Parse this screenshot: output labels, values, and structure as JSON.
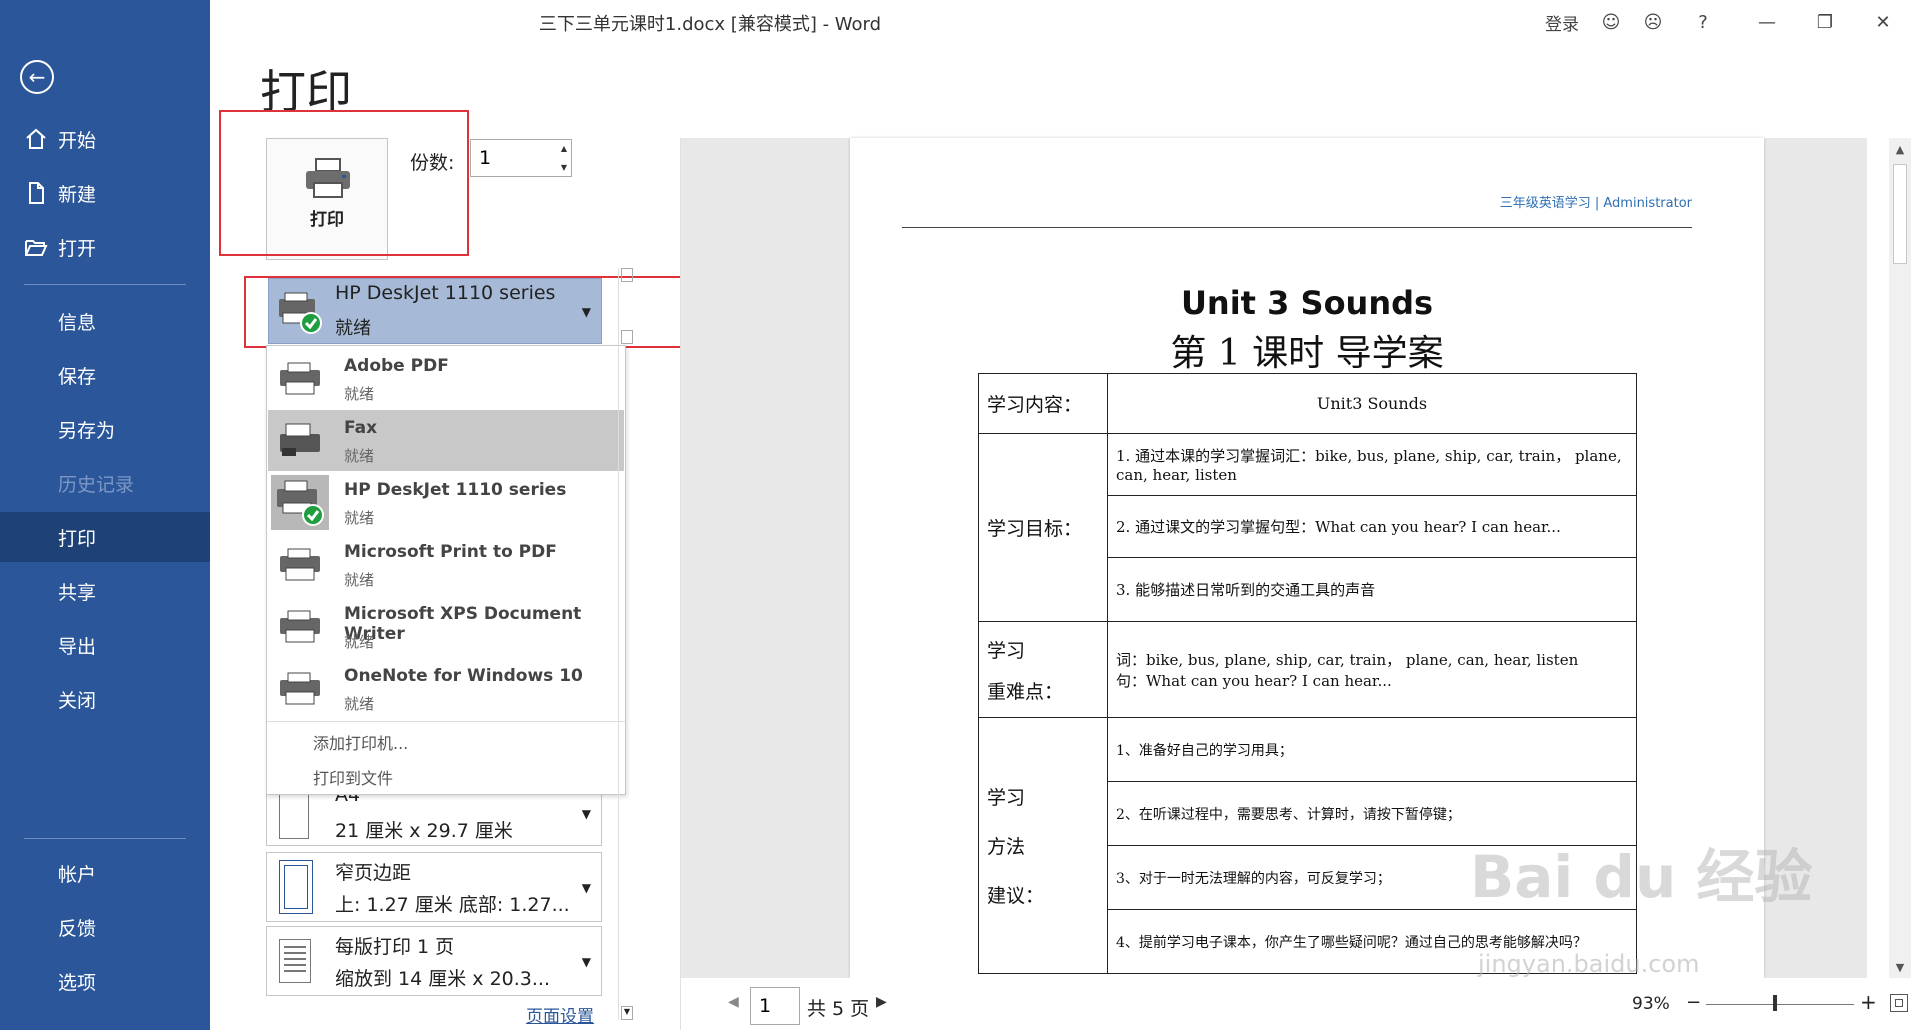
{
  "window": {
    "title": "三下三单元课时1.docx [兼容模式]  -  Word",
    "sign_in": "登录",
    "help": "?"
  },
  "sidebar": {
    "items": [
      {
        "label": "开始",
        "icon": "home-icon"
      },
      {
        "label": "新建",
        "icon": "new-document-icon"
      },
      {
        "label": "打开",
        "icon": "open-folder-icon"
      },
      {
        "label": "信息"
      },
      {
        "label": "保存"
      },
      {
        "label": "另存为"
      },
      {
        "label": "历史记录"
      },
      {
        "label": "打印"
      },
      {
        "label": "共享"
      },
      {
        "label": "导出"
      },
      {
        "label": "关闭"
      },
      {
        "label": "帐户"
      },
      {
        "label": "反馈"
      },
      {
        "label": "选项"
      }
    ]
  },
  "print": {
    "title": "打印",
    "button_label": "打印",
    "copies_label": "份数:",
    "copies_value": "1",
    "selected_printer": {
      "name": "HP DeskJet 1110 series",
      "status": "就绪"
    },
    "printers": [
      {
        "name": "Adobe PDF",
        "status": "就绪"
      },
      {
        "name": "Fax",
        "status": "就绪"
      },
      {
        "name": "HP DeskJet 1110 series",
        "status": "就绪"
      },
      {
        "name": "Microsoft Print to PDF",
        "status": "就绪"
      },
      {
        "name": "Microsoft XPS Document Writer",
        "status": "就绪"
      },
      {
        "name": "OneNote for Windows 10",
        "status": "就绪"
      }
    ],
    "commands": {
      "add_printer": "添加打印机...",
      "print_to_file": "打印到文件"
    },
    "settings": {
      "paper": {
        "line1": "A4",
        "line2": "21 厘米 x 29.7 厘米"
      },
      "margins": {
        "line1": "窄页边距",
        "line2": "上: 1.27 厘米 底部: 1.27..."
      },
      "pages_per_sheet": {
        "line1": "每版打印 1 页",
        "line2": "缩放到 14 厘米 x 20.3..."
      }
    },
    "page_setup_link": "页面设置"
  },
  "preview": {
    "header": "三年级英语学习 | Administrator",
    "title": "Unit 3 Sounds",
    "subtitle": "第 1 课时  导学案",
    "table": {
      "content_label": "学习内容：",
      "content_value": "Unit3 Sounds",
      "goals_label": "学习目标：",
      "goals": [
        "1. 通过本课的学习掌握词汇：bike, bus, plane, ship, car, train， plane, can, hear, listen",
        "2. 通过课文的学习掌握句型：What can you hear? I can hear...",
        "3. 能够描述日常听到的交通工具的声音"
      ],
      "key_label_1": "学习",
      "key_label_2": "重难点：",
      "key_words": "词：bike, bus, plane, ship, car, train， plane, can, hear, listen",
      "key_sentence": "句：What can you hear? I can hear...",
      "method_label_1": "学习",
      "method_label_2": "方法",
      "method_label_3": "建议：",
      "methods": [
        "1、准备好自己的学习用具；",
        "2、在听课过程中，需要思考、计算时，请按下暂停键；",
        "3、对于一时无法理解的内容，可反复学习；",
        "4、提前学习电子课本，你产生了哪些疑问呢？通过自己的思考能够解决吗？"
      ]
    }
  },
  "bottom": {
    "page_value": "1",
    "page_total": "共 5 页",
    "zoom": "93%",
    "zoom_minus": "−",
    "zoom_plus": "+"
  },
  "watermark": {
    "text": "Bai du 经验",
    "url": "jingyan.baidu.com"
  },
  "colors": {
    "sidebar": "#2b579a",
    "sidebar_active": "#1e4276",
    "highlight_box": "#e0303a",
    "selected_printer": "#a6b9d6"
  }
}
